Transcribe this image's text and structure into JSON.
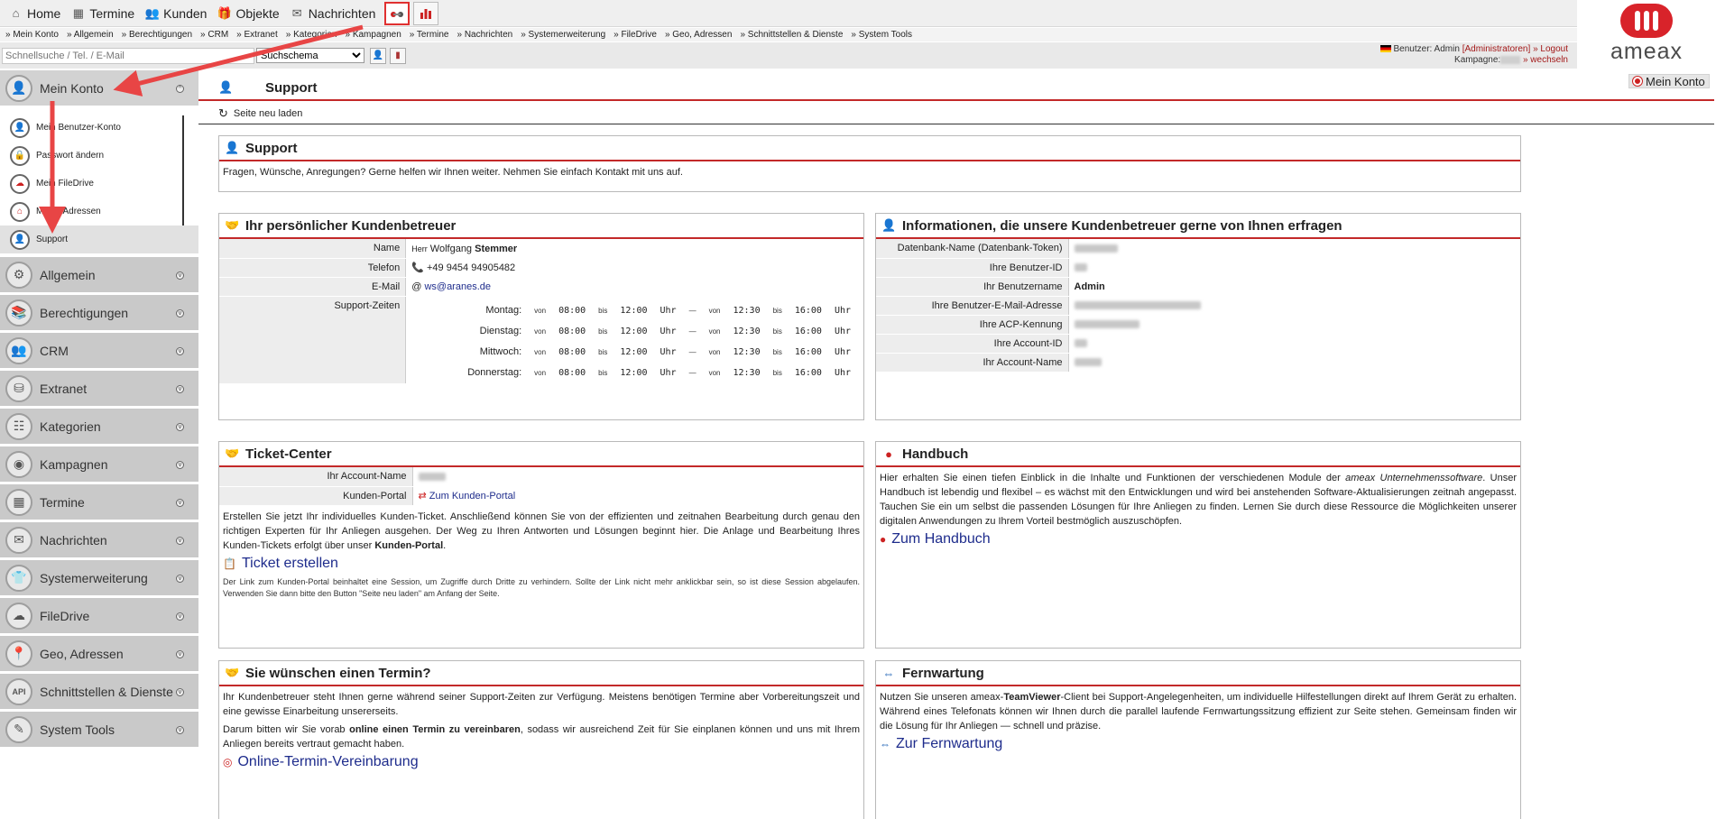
{
  "topnav": {
    "items": [
      {
        "label": "Home",
        "icon": "home-icon"
      },
      {
        "label": "Termine",
        "icon": "calendar-icon"
      },
      {
        "label": "Kunden",
        "icon": "customers-icon"
      },
      {
        "label": "Objekte",
        "icon": "objects-icon"
      },
      {
        "label": "Nachrichten",
        "icon": "messages-icon"
      }
    ]
  },
  "subnav": {
    "links": [
      "» Mein Konto",
      "» Allgemein",
      "» Berechtigungen",
      "» CRM",
      "» Extranet",
      "» Kategorien",
      "» Kampagnen",
      "» Termine",
      "» Nachrichten",
      "» Systemerweiterung",
      "» FileDrive",
      "» Geo, Adressen",
      "» Schnittstellen & Dienste",
      "» System Tools"
    ]
  },
  "search": {
    "placeholder": "Schnellsuche / Tel. / E-Mail",
    "select_value": "Suchschema"
  },
  "user": {
    "prefix": "Benutzer:",
    "name": "Admin",
    "role": "[Administratoren]",
    "logout": "» Logout",
    "campaign_label": "Kampagne:",
    "switch": "» wechseln"
  },
  "logo_text": "ameax",
  "konto_badge": "Mein Konto",
  "sidebar": {
    "active_section": "Mein Konto",
    "subitems": [
      {
        "label": "Mein Benutzer-Konto",
        "icon": "user-account-icon"
      },
      {
        "label": "Passwort ändern",
        "icon": "lock-icon"
      },
      {
        "label": "Mein FileDrive",
        "icon": "filedrive-icon"
      },
      {
        "label": "Meine Adressen",
        "icon": "address-icon"
      },
      {
        "label": "Support",
        "icon": "support-icon"
      }
    ],
    "sections": [
      {
        "label": "Allgemein",
        "icon": "gear-icon"
      },
      {
        "label": "Berechtigungen",
        "icon": "books-icon"
      },
      {
        "label": "CRM",
        "icon": "crm-icon"
      },
      {
        "label": "Extranet",
        "icon": "extranet-icon"
      },
      {
        "label": "Kategorien",
        "icon": "categories-icon"
      },
      {
        "label": "Kampagnen",
        "icon": "campaign-icon"
      },
      {
        "label": "Termine",
        "icon": "calendar-icon"
      },
      {
        "label": "Nachrichten",
        "icon": "envelope-icon"
      },
      {
        "label": "Systemerweiterung",
        "icon": "extension-icon"
      },
      {
        "label": "FileDrive",
        "icon": "drive-icon"
      },
      {
        "label": "Geo, Adressen",
        "icon": "geo-icon"
      },
      {
        "label": "Schnittstellen & Dienste",
        "icon": "api-icon"
      },
      {
        "label": "System Tools",
        "icon": "tools-icon"
      }
    ]
  },
  "page": {
    "title": "Support",
    "reload": "Seite neu laden"
  },
  "support_panel": {
    "title": "Support",
    "text": "Fragen, Wünsche, Anregungen? Gerne helfen wir Ihnen weiter. Nehmen Sie einfach Kontakt mit uns auf."
  },
  "advisor_panel": {
    "title": "Ihr persönlicher Kundenbetreuer",
    "name_label": "Name",
    "name_salutation": "Herr",
    "name_first": "Wolfgang",
    "name_last": "Stemmer",
    "phone_label": "Telefon",
    "phone": "+49 9454 94905482",
    "email_label": "E-Mail",
    "email": "ws@aranes.de",
    "hours_label": "Support-Zeiten",
    "hours": [
      {
        "day": "Montag:",
        "a_from": "08:00",
        "a_to": "12:00",
        "b_from": "12:30",
        "b_to": "16:00"
      },
      {
        "day": "Dienstag:",
        "a_from": "08:00",
        "a_to": "12:00",
        "b_from": "12:30",
        "b_to": "16:00"
      },
      {
        "day": "Mittwoch:",
        "a_from": "08:00",
        "a_to": "12:00",
        "b_from": "12:30",
        "b_to": "16:00"
      },
      {
        "day": "Donnerstag:",
        "a_from": "08:00",
        "a_to": "12:00",
        "b_from": "12:30",
        "b_to": "16:00"
      }
    ],
    "von": "von",
    "bis": "bis",
    "uhr": "Uhr",
    "dash": "—"
  },
  "info_panel": {
    "title": "Informationen, die unsere Kundenbetreuer gerne von Ihnen erfragen",
    "rows": [
      {
        "label": "Datenbank-Name (Datenbank-Token)",
        "value": ""
      },
      {
        "label": "Ihre Benutzer-ID",
        "value": ""
      },
      {
        "label": "Ihr Benutzername",
        "value": "Admin"
      },
      {
        "label": "Ihre Benutzer-E-Mail-Adresse",
        "value": ""
      },
      {
        "label": "Ihre ACP-Kennung",
        "value": ""
      },
      {
        "label": "Ihre Account-ID",
        "value": ""
      },
      {
        "label": "Ihr Account-Name",
        "value": ""
      }
    ]
  },
  "ticket_panel": {
    "title": "Ticket-Center",
    "account_label": "Ihr Account-Name",
    "portal_label": "Kunden-Portal",
    "portal_link": "Zum Kunden-Portal",
    "text_1": "Erstellen Sie jetzt Ihr individuelles Kunden-Ticket. Anschließend können Sie von der effizienten und zeitnahen Bearbeitung durch genau den richtigen Experten für Ihr Anliegen ausgehen. Der Weg zu Ihren Antworten und Lösungen beginnt hier. Die Anlage und Bearbeitung Ihres Kunden-Tickets erfolgt über unser",
    "text_1_bold": "Kunden-Portal",
    "text_1_end": ".",
    "create_link": "Ticket erstellen",
    "note": "Der Link zum Kunden-Portal beinhaltet eine Session, um Zugriffe durch Dritte zu verhindern. Sollte der Link nicht mehr anklickbar sein, so ist diese Session abgelaufen. Verwenden Sie dann bitte den Button \"Seite neu laden\" am Anfang der Seite."
  },
  "manual_panel": {
    "title": "Handbuch",
    "text_a": "Hier erhalten Sie einen tiefen Einblick in die Inhalte und Funktionen der verschiedenen Module der",
    "text_em": "ameax Unternehmenssoftware",
    "text_b": ". Unser Handbuch ist lebendig und flexibel – es wächst mit den Entwicklungen und wird bei anstehenden Software-Aktualisierungen zeitnah angepasst. Tauchen Sie ein um selbst die passenden Lösungen für Ihre Anliegen zu finden. Lernen Sie durch diese Ressource die Möglichkeiten unserer digitalen Anwendungen zu Ihrem Vorteil bestmöglich auszuschöpfen.",
    "link": "Zum Handbuch"
  },
  "appointment_panel": {
    "title": "Sie wünschen einen Termin?",
    "text_1": "Ihr Kundenbetreuer steht Ihnen gerne während seiner Support-Zeiten zur Verfügung. Meistens benötigen Termine aber Vorbereitungszeit und eine gewisse Einarbeitung unsererseits.",
    "text_2a": "Darum bitten wir Sie vorab",
    "text_2b": "online einen Termin zu vereinbaren",
    "text_2c": ", sodass wir ausreichend Zeit für Sie einplanen können und uns mit Ihrem Anliegen bereits vertraut gemacht haben.",
    "link": "Online-Termin-Vereinbarung"
  },
  "remote_panel": {
    "title": "Fernwartung",
    "text_a": "Nutzen Sie unseren ameax-",
    "text_b": "TeamViewer",
    "text_c": "-Client bei Support-Angelegenheiten, um individuelle Hilfestellungen direkt auf Ihrem Gerät zu erhalten. Während eines Telefonats können wir Ihnen durch die parallel laufende Fernwartungssitzung effizient zur Seite stehen. Gemeinsam finden wir die Lösung für Ihr Anliegen — schnell und präzise.",
    "link": "Zur Fernwartung"
  },
  "colors": {
    "accent_red": "#c32929",
    "link_blue": "#1e2c8c",
    "sidebar_gray": "#c9c9c9"
  }
}
